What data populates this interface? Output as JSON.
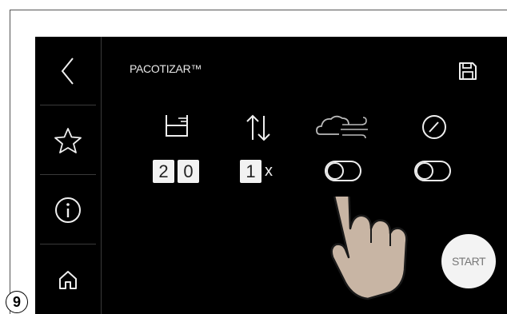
{
  "screen": {
    "title": "PACOTIZAR™",
    "sidebar": {
      "items": [
        {
          "icon": "back-chevron-icon"
        },
        {
          "icon": "star-icon"
        },
        {
          "icon": "info-icon"
        },
        {
          "icon": "home-icon"
        }
      ]
    },
    "save_icon": "save-icon",
    "settings": {
      "portion_digits": [
        "2",
        "0"
      ],
      "repeat_digit": "1",
      "repeat_suffix": "x",
      "overrun_toggle_on": false,
      "pressure_toggle_on": false
    },
    "start_label": "START"
  },
  "figure_number": "9"
}
